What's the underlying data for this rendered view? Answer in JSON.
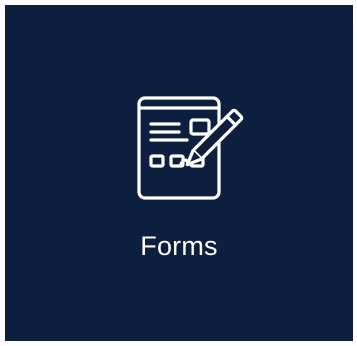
{
  "tile": {
    "label": "Forms",
    "icon": "form-edit-icon",
    "background_color": "#0c1f3f",
    "foreground_color": "#ffffff"
  }
}
